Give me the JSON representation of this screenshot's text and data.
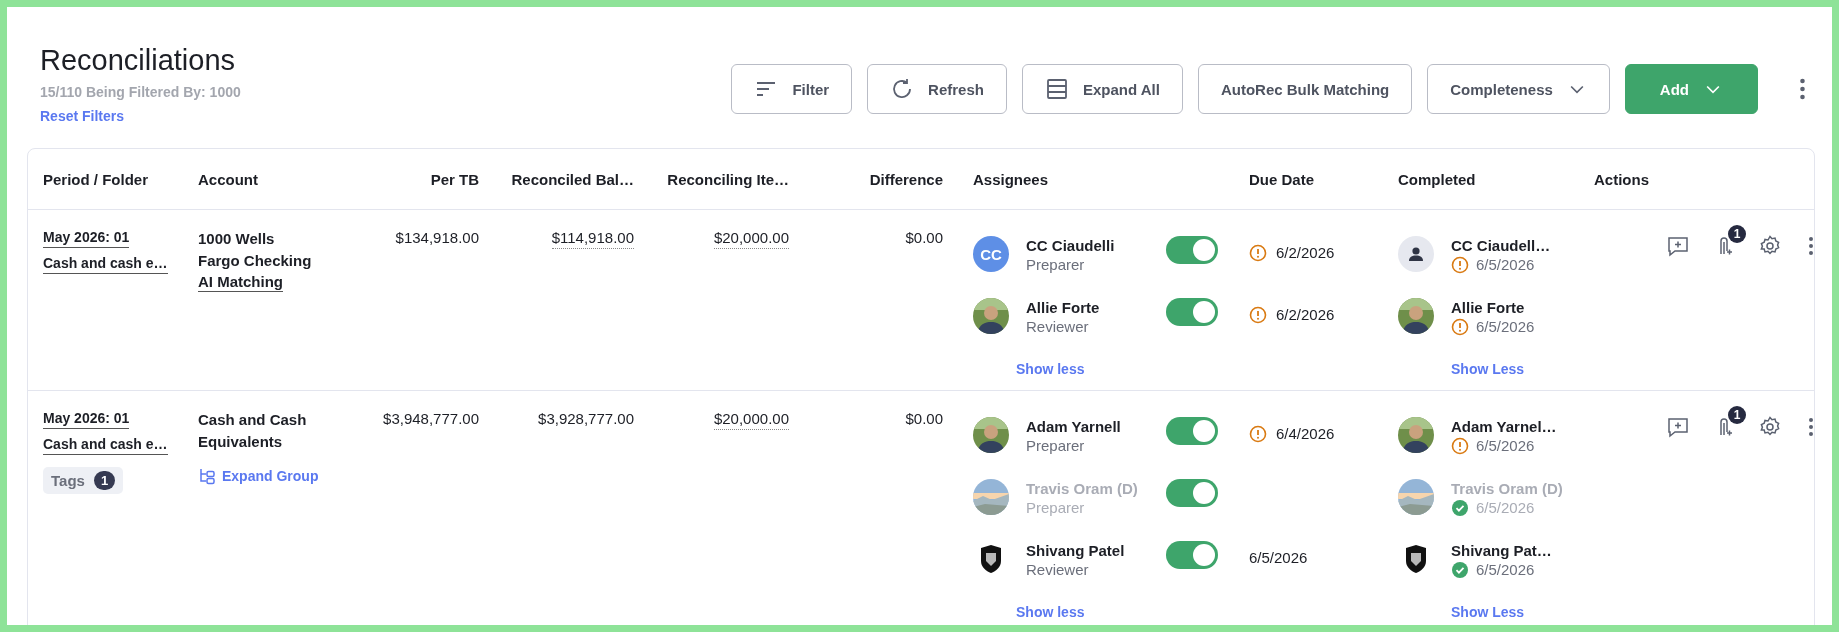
{
  "header": {
    "title": "Reconciliations",
    "subtitle": "15/110 Being Filtered By: 1000",
    "reset_link": "Reset Filters"
  },
  "toolbar": [
    {
      "label": "Filter",
      "kind": "filter"
    },
    {
      "label": "Refresh",
      "kind": "refresh"
    },
    {
      "label": "Expand All",
      "kind": "expand"
    },
    {
      "label": "AutoRec Bulk Matching",
      "kind": "plain"
    },
    {
      "label": "Completeness",
      "kind": "select"
    },
    {
      "label": "Add",
      "kind": "primary"
    }
  ],
  "table": {
    "columns": [
      "Period / Folder",
      "Account",
      "Per TB",
      "Reconciled Bal…",
      "Reconciling Ite…",
      "Difference",
      "Assignees",
      "Due Date",
      "Completed",
      "Actions"
    ],
    "rows": [
      {
        "period": "May 2026: 01",
        "folder": "Cash and cash e…",
        "account": "1000 Wells Fargo Checking",
        "account_link": "AI Matching",
        "per_tb": "$134,918.00",
        "reconciled": {
          "text": "$114,918.00",
          "linked": true
        },
        "reconciling": {
          "text": "$20,000.00",
          "linked": true
        },
        "difference": "$0.00",
        "assignees": [
          {
            "kind": "initials",
            "initials": "CC",
            "name": "CC Ciaudelli",
            "role": "Preparer",
            "disabled": false,
            "on": true,
            "due": "6/2/2026",
            "overdue": true
          },
          {
            "name": "Allie Forte",
            "role": "Reviewer",
            "disabled": false,
            "on": true,
            "due": "6/2/2026",
            "overdue": true
          }
        ],
        "assignees_toggle": "Show less",
        "completed": [
          {
            "kind": "placeholder",
            "name": "CC Ciaudell…",
            "date": "6/5/2026",
            "done": false,
            "disabled": false
          },
          {
            "name": "Allie Forte",
            "date": "6/5/2026",
            "done": false,
            "disabled": false
          }
        ],
        "completed_toggle": "Show Less",
        "attachments": "1"
      },
      {
        "period": "May 2026: 01",
        "folder": "Cash and cash e…",
        "tags": {
          "label": "Tags",
          "count": "1"
        },
        "account": "Cash and Cash Equivalents",
        "group_link": "Expand Group",
        "per_tb": "$3,948,777.00",
        "reconciled": {
          "text": "$3,928,777.00",
          "linked": false
        },
        "reconciling": {
          "text": "$20,000.00",
          "linked": true
        },
        "difference": "$0.00",
        "assignees": [
          {
            "name": "Adam Yarnell",
            "role": "Preparer",
            "disabled": false,
            "on": true,
            "due": "6/4/2026",
            "overdue": true
          },
          {
            "kind": "landscape",
            "name": "Travis Oram (D)",
            "role": "Preparer",
            "disabled": true,
            "on": true
          },
          {
            "kind": "logo",
            "name": "Shivang Patel",
            "role": "Reviewer",
            "disabled": false,
            "on": true,
            "due": "6/5/2026",
            "overdue": false
          }
        ],
        "assignees_toggle": "Show less",
        "completed": [
          {
            "name": "Adam Yarnel…",
            "date": "6/5/2026",
            "done": false,
            "disabled": false
          },
          {
            "kind": "landscape",
            "name": "Travis Oram (D)",
            "date": "6/5/2026",
            "done": true,
            "disabled": true
          },
          {
            "kind": "logo",
            "name": "Shivang Pat…",
            "date": "6/5/2026",
            "done": true,
            "disabled": false
          }
        ],
        "completed_toggle": "Show Less",
        "attachments": "1"
      }
    ]
  }
}
